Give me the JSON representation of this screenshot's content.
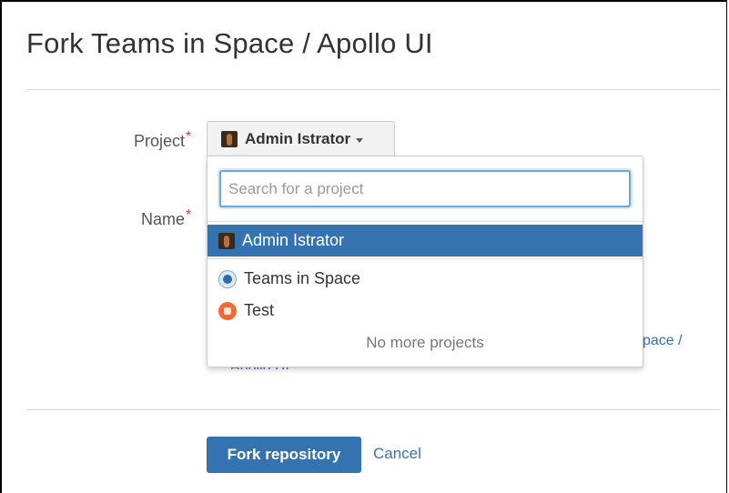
{
  "dialog": {
    "title": "Fork Teams in Space / Apollo UI"
  },
  "form": {
    "project_label": "Project",
    "name_label": "Name",
    "required_marker": "*",
    "project_value": "Admin Istrator"
  },
  "dropdown": {
    "search_placeholder": "Search for a project",
    "search_value": "",
    "selected_item": {
      "label": "Admin Istrator",
      "icon": "user-avatar-icon"
    },
    "items": [
      {
        "label": "Teams in Space",
        "icon": "teams-in-space-project-icon"
      },
      {
        "label": "Test",
        "icon": "test-project-icon"
      }
    ],
    "footer_text": "No more projects"
  },
  "background": {
    "link_fragment_1": "pace /",
    "link_fragment_2": "Apollo UI."
  },
  "actions": {
    "fork_button": "Fork repository",
    "cancel_link": "Cancel"
  },
  "colors": {
    "primary": "#3572b0",
    "required": "#d04437",
    "focus_border": "#6aa6e0"
  }
}
